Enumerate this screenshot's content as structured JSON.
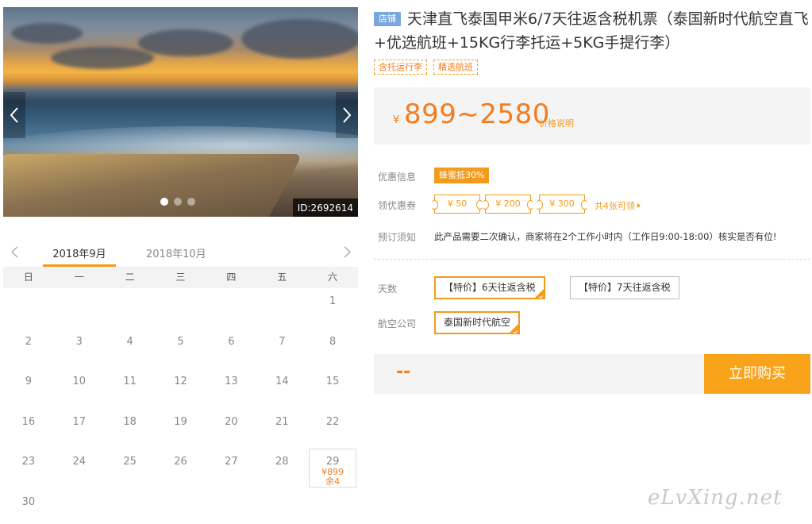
{
  "gallery": {
    "image_id": "ID:2692614",
    "dots": 3,
    "active_dot": 0
  },
  "calendar": {
    "months": [
      "2018年9月",
      "2018年10月"
    ],
    "weekdays": [
      "日",
      "一",
      "二",
      "三",
      "四",
      "五",
      "六"
    ],
    "rows": [
      [
        "",
        "",
        "",
        "",
        "",
        "",
        "1"
      ],
      [
        "2",
        "3",
        "4",
        "5",
        "6",
        "7",
        "8"
      ],
      [
        "9",
        "10",
        "11",
        "12",
        "13",
        "14",
        "15"
      ],
      [
        "16",
        "17",
        "18",
        "19",
        "20",
        "21",
        "22"
      ],
      [
        "23",
        "24",
        "25",
        "26",
        "27",
        "28",
        "29"
      ],
      [
        "30",
        "",
        "",
        "",
        "",
        "",
        ""
      ]
    ],
    "available": {
      "day": "29",
      "price": "¥899",
      "stock": "余4"
    }
  },
  "product": {
    "shop_badge": "店铺",
    "title": "天津直飞泰国甲米6/7天往返含税机票（泰国新时代航空直飞+优选航班+15KG行李托运+5KG手提行李）",
    "tags": [
      "含托运行李",
      "精选航班"
    ]
  },
  "price": {
    "currency": "¥",
    "range": "899~2580",
    "explain": "价格说明"
  },
  "promo": {
    "label": "优惠信息",
    "badge": "蜂蜜抵30%"
  },
  "coupons": {
    "label": "领优惠券",
    "items": [
      "¥ 50",
      "¥ 200",
      "¥ 300"
    ],
    "more": "共4张可领"
  },
  "notice": {
    "label": "预订须知",
    "text": "此产品需要二次确认，商家将在2个工作小时内（工作日9:00-18:00）核实是否有位!"
  },
  "days": {
    "label": "天数",
    "options": [
      "【特价】6天往返含税",
      "【特价】7天往返含税"
    ],
    "selected": 0
  },
  "airline": {
    "label": "航空公司",
    "options": [
      "泰国新时代航空"
    ],
    "selected": 0
  },
  "buy": {
    "total": "--",
    "button": "立即购买"
  },
  "watermark": "eLvXing.net",
  "colors": {
    "accent": "#f39b1d",
    "price": "#f37c1d",
    "shop_badge": "#79a7dd",
    "buy_button": "#f9a31b"
  }
}
